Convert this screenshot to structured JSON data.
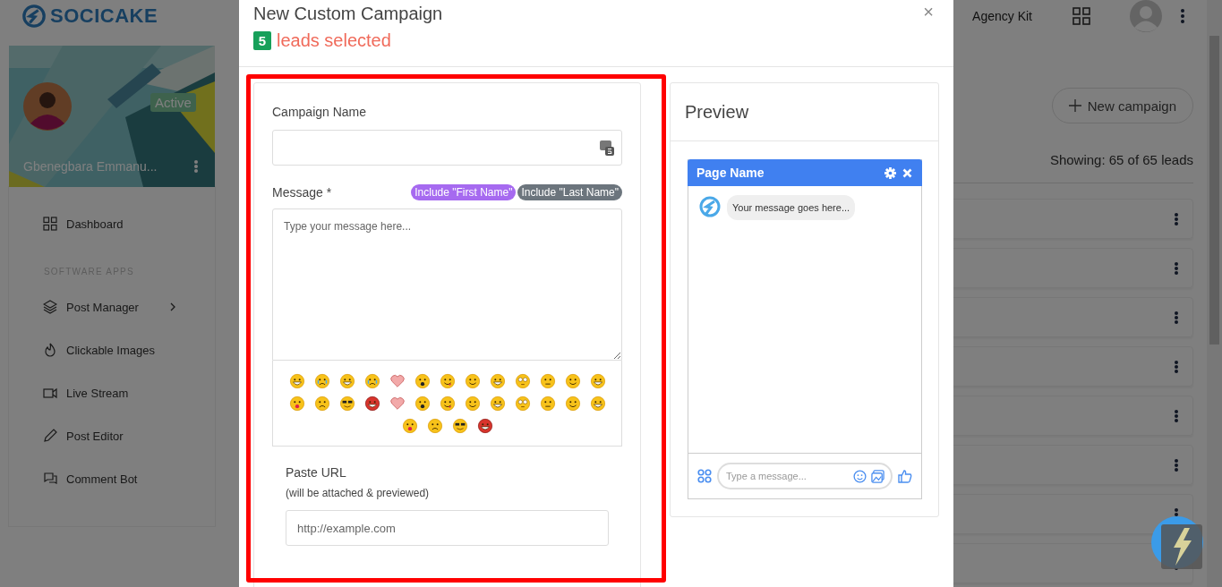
{
  "header": {
    "logo": "SOCICAKE",
    "nav": [
      "Agency Kit"
    ]
  },
  "sidebar": {
    "profile": {
      "name": "Gbenegbara Emmanu...",
      "status": "Active"
    },
    "items": [
      {
        "label": "Dashboard",
        "kind": "link"
      },
      {
        "label": "SOFTWARE APPS",
        "kind": "heading"
      },
      {
        "label": "Post Manager",
        "kind": "link",
        "expandable": true
      },
      {
        "label": "Clickable Images",
        "kind": "link"
      },
      {
        "label": "Live Stream",
        "kind": "link"
      },
      {
        "label": "Post Editor",
        "kind": "link"
      },
      {
        "label": "Comment Bot",
        "kind": "link"
      }
    ]
  },
  "content": {
    "new_campaign": "New campaign",
    "showing": "Showing: 65 of 65 leads"
  },
  "modal": {
    "title": "New Custom Campaign",
    "close": "×",
    "count": "5",
    "count_label": "leads selected",
    "campaign_name": {
      "label": "Campaign Name"
    },
    "message": {
      "label": "Message *",
      "placeholder": "Type your message here...",
      "chips": [
        {
          "label": "Include \"First Name\"",
          "color": "#a66af0"
        },
        {
          "label": "Include \"Last Name\"",
          "color": "#6c757d"
        }
      ]
    },
    "emojis": [
      {
        "kind": "grin"
      },
      {
        "kind": "cry"
      },
      {
        "kind": "grin"
      },
      {
        "kind": "cry"
      },
      {
        "kind": "heart"
      },
      {
        "kind": "shock"
      },
      {
        "kind": "tongue"
      },
      {
        "kind": "smile"
      },
      {
        "kind": "scream"
      },
      {
        "kind": "dizzy"
      },
      {
        "kind": "neutral"
      },
      {
        "kind": "smile"
      },
      {
        "kind": "laugh"
      },
      {
        "kind": "kiss"
      },
      {
        "kind": "sad"
      },
      {
        "kind": "cool"
      },
      {
        "kind": "devil"
      },
      {
        "kind": "heart"
      },
      {
        "kind": "shock"
      },
      {
        "kind": "tongue"
      },
      {
        "kind": "smile"
      },
      {
        "kind": "scream"
      },
      {
        "kind": "dizzy"
      },
      {
        "kind": "neutral"
      },
      {
        "kind": "smile"
      },
      {
        "kind": "laugh"
      },
      {
        "kind": "kiss"
      },
      {
        "kind": "sad"
      },
      {
        "kind": "cool"
      },
      {
        "kind": "devil"
      }
    ],
    "url": {
      "label": "Paste URL",
      "hint": "(will be attached & previewed)",
      "placeholder": "http://example.com"
    },
    "preview": {
      "title": "Preview",
      "page_name": "Page Name",
      "message": "Your message goes here...",
      "placeholder": "Type a message..."
    }
  }
}
